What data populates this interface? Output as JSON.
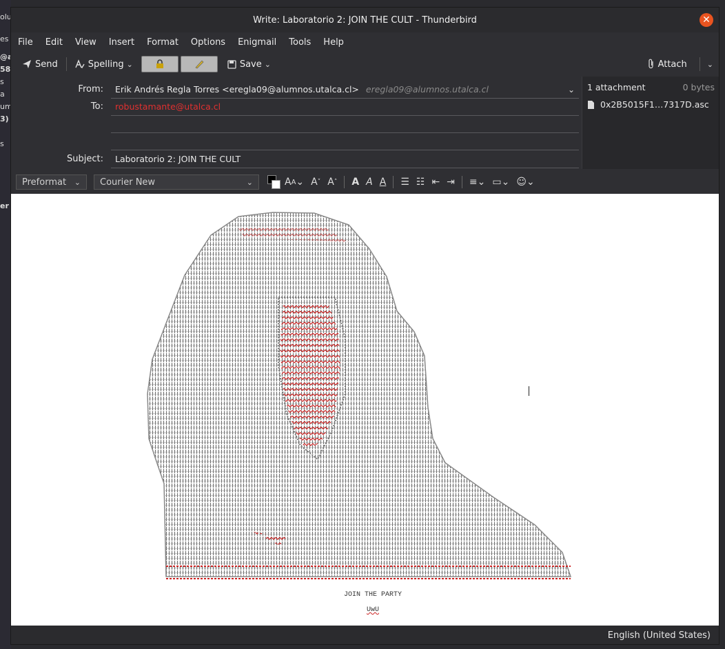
{
  "background_sidebar": {
    "fragments": [
      "olu",
      "es",
      "@al",
      "58",
      "s",
      "a",
      "um",
      "3)",
      "s",
      "er"
    ]
  },
  "window": {
    "title": "Write: Laboratorio 2: JOIN THE CULT - Thunderbird",
    "close_glyph": "✕"
  },
  "menubar": {
    "items": [
      {
        "label": "File"
      },
      {
        "label": "Edit"
      },
      {
        "label": "View"
      },
      {
        "label": "Insert"
      },
      {
        "label": "Format"
      },
      {
        "label": "Options"
      },
      {
        "label": "Enigmail"
      },
      {
        "label": "Tools"
      },
      {
        "label": "Help"
      }
    ]
  },
  "toolbar": {
    "send_label": "Send",
    "spelling_label": "Spelling",
    "save_label": "Save",
    "attach_label": "Attach"
  },
  "headers": {
    "from_label": "From:",
    "from_value": "Erik Andrés Regla Torres <eregla09@alumnos.utalca.cl>",
    "from_secondary": "eregla09@alumnos.utalca.cl",
    "to_label": "To:",
    "to_value": "robustamante@utalca.cl",
    "subject_label": "Subject:",
    "subject_value": "Laboratorio 2: JOIN THE CULT"
  },
  "attachments": {
    "header": "1 attachment",
    "total_size": "0 bytes",
    "items": [
      {
        "name": "0x2B5015F1…7317D.asc"
      }
    ]
  },
  "format_bar": {
    "paragraph_format": "Preformat",
    "font": "Courier New"
  },
  "editor": {
    "caption": "JOIN THE PARTY",
    "subcaption": "UwU"
  },
  "statusbar": {
    "language": "English (United States)"
  },
  "colors": {
    "close": "#e95420",
    "recipient": "#e03030",
    "art_main": "#555555",
    "art_red": "#cc2222"
  }
}
